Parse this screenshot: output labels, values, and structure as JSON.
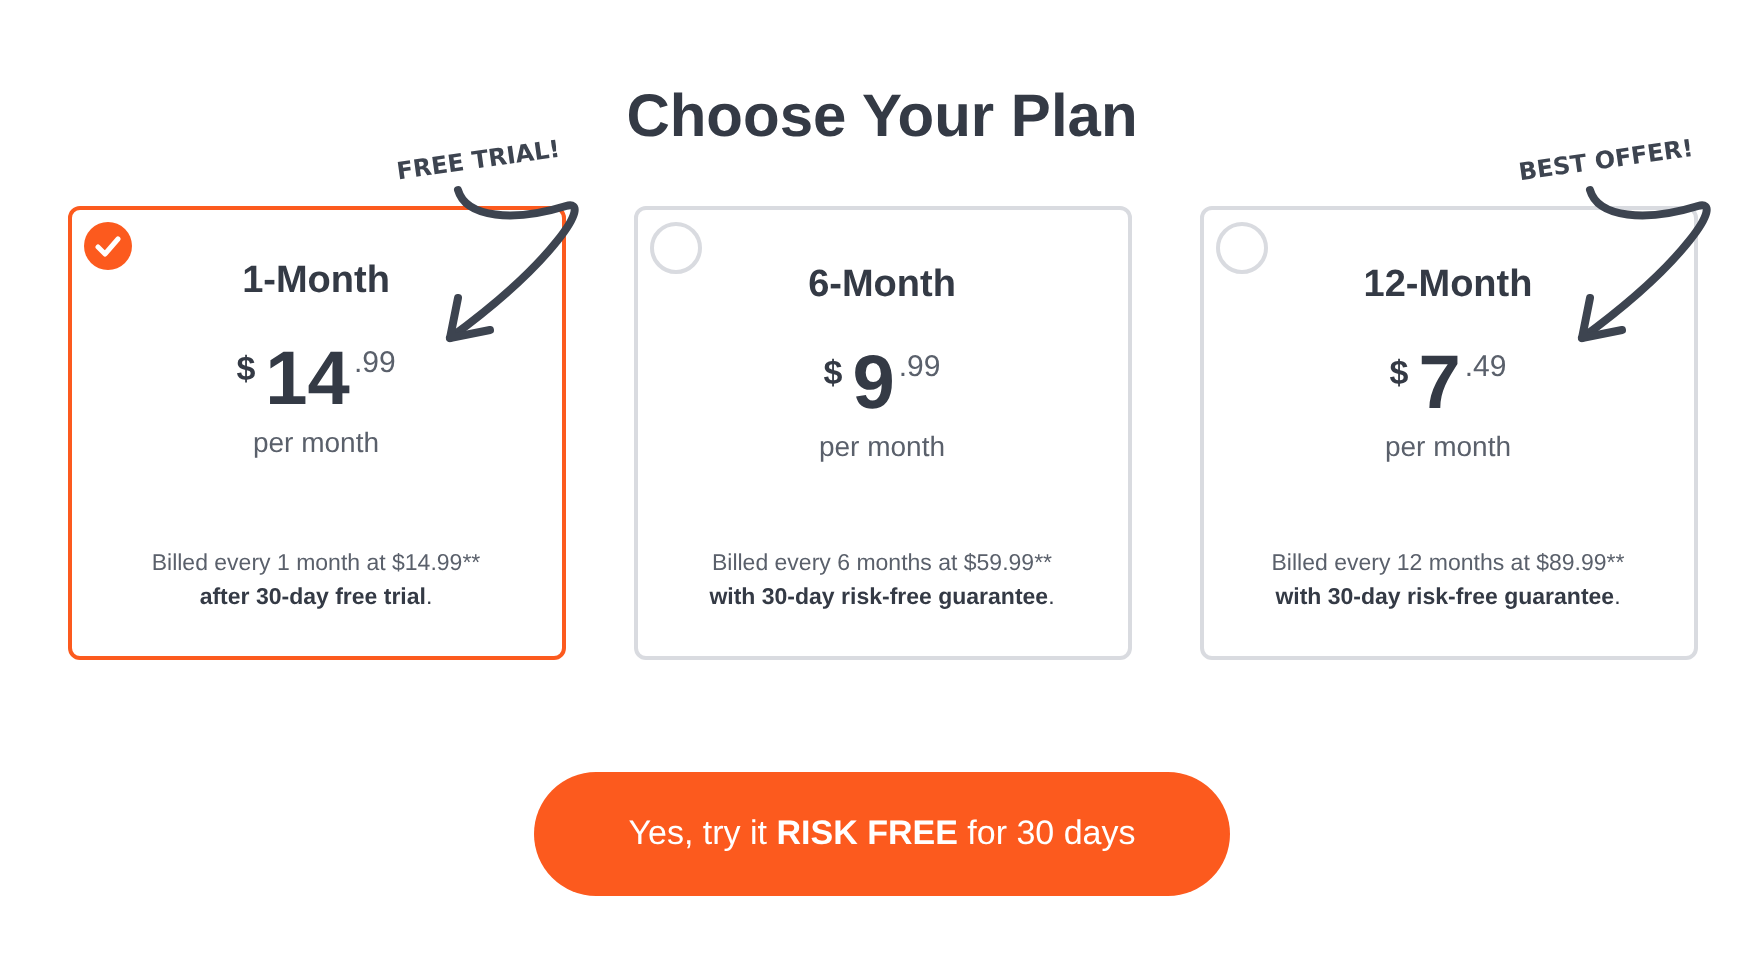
{
  "title": "Choose Your Plan",
  "plans": [
    {
      "name": "1-Month",
      "selected": true,
      "currency": "$",
      "whole": "14",
      "cents": ".99",
      "period": "per month",
      "billing": "Billed every 1 month at $14.99**",
      "terms": "**after 30-day free trial**.",
      "badge": "FREE TRIAL!"
    },
    {
      "name": "6-Month",
      "selected": false,
      "currency": "$",
      "whole": "9",
      "cents": ".99",
      "period": "per month",
      "billing": "Billed every 6 months at $59.99**",
      "terms": "**with 30-day risk-free guarantee**."
    },
    {
      "name": "12-Month",
      "selected": false,
      "currency": "$",
      "whole": "7",
      "cents": ".49",
      "period": "per month",
      "billing": "Billed every 12 months at $89.99**",
      "terms": "**with 30-day risk-free guarantee**.",
      "badge": "BEST OFFER!"
    }
  ],
  "cta": "Yes, try it **RISK FREE** for 30 days"
}
